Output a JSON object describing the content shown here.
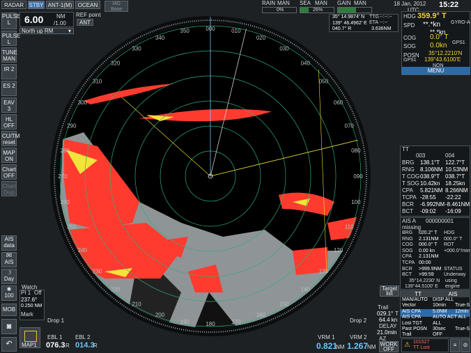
{
  "top_bar": {
    "radar": "RADAR",
    "stby": "STBY",
    "ant": "ANT-1(M)",
    "ocean": "OCEAN",
    "iad_base": "IAD\nBase",
    "pulse_lbl": "PULSE",
    "pulse_val": "L",
    "range_main": "6.00",
    "range_unit": "NM",
    "range_rings": "/1.00",
    "ref_point_lbl": "REF point",
    "ref_point_val": "ANT",
    "orientation": "North up RM",
    "rain_lbl": "RAIN",
    "rain_mode": "MAN",
    "rain_pct": "0%",
    "rain_level": 0.0,
    "sea_lbl": "SEA",
    "sea_mode": "MAN",
    "sea_pct": "26%",
    "sea_level": 0.26,
    "gain_lbl": "GAIN",
    "gain_mode": "MAN",
    "gain_level": 0.55,
    "date": "18 Jan, 2012",
    "time": "15:22",
    "tz": "UTC"
  },
  "cursor": {
    "lat": "35° 14.9874' N",
    "lon": "139° 46.4962' E",
    "brg": "040.7° R",
    "rng": "3.636NM",
    "ttg_lbl": "TTG",
    "eta_lbl": "ETA",
    "ttg_val": "--:--:--",
    "eta_val": "--:--"
  },
  "nav": {
    "hdg_lbl": "HDG",
    "hdg_val": "359.9° T",
    "hdg_src": "GYRO-A",
    "spd_lbl": "SPD",
    "spd_val": "**.*kn",
    "spd_src": "**.*kn",
    "cog_lbl": "COG",
    "cog_val": "0.0° T",
    "sog_lbl": "SOG",
    "sog_val": "0.0kn",
    "gps1": "GPS1",
    "posn_lbl": "POSN",
    "posn_lat": "35°12.2210'N",
    "posn_lon": "139°43.6100'E",
    "posn_src": "GPS1",
    "non": "NON",
    "menu": "MENU"
  },
  "left_menu": [
    "PULSE L",
    "TUNE MAN",
    "IR 2",
    "ES 2",
    "EAV 3",
    "HL OFF",
    "CU/TM reset",
    "MAP ON",
    "Chart OFF",
    "Chart Disp"
  ],
  "left_bottom": {
    "ais_data": "AIS data",
    "ais": "AIS",
    "day": "Day",
    "brill": "100",
    "mob": "MOB",
    "watch": "Watch",
    "pi1": "PI 1",
    "pi_off": "Off",
    "pi_val1": "237.6°",
    "pi_val2": "0.250 NM",
    "mark": "Mark",
    "map1": "MAP1",
    "drop1": "Drop 1",
    "ebl1": "EBL 1",
    "ebl1_val": "076.3",
    "ebl2": "EBL 2",
    "ebl2_val": "014.3",
    "r": "R"
  },
  "bottom_right": {
    "drop2": "Drop 2",
    "trail": "Trail",
    "trail_val": "029.1°",
    "trail_r": "T",
    "trail_rng": "64.4 kn",
    "delay": "DELAY",
    "delay_val": "21.0min",
    "vrm1": "VRM 1",
    "vrm1_val": "0.821",
    "vrm2": "VRM 2",
    "vrm2_val": "1.267",
    "nm": "NM",
    "az": "AZ",
    "work": "WORK",
    "off": "OFF",
    "alert_num": "101527",
    "alert_txt": "TT Lost"
  },
  "scale": {
    "outer": [
      "000",
      "010",
      "020",
      "030",
      "040",
      "050",
      "060",
      "070",
      "080",
      "090",
      "100",
      "110",
      "120",
      "130",
      "140",
      "150",
      "160",
      "170",
      "180",
      "190",
      "200",
      "210",
      "220",
      "230",
      "240",
      "250",
      "260",
      "270",
      "280",
      "290",
      "300",
      "310",
      "320",
      "330",
      "340",
      "350"
    ]
  },
  "tt_panel": {
    "title": "TT",
    "id1": "003",
    "id2": "004",
    "rows": [
      {
        "k": "BRG",
        "a": "138.1°T",
        "b": "122.7°T"
      },
      {
        "k": "RNG",
        "a": "8.106NM",
        "b": "10.53NM"
      },
      {
        "k": "T COG",
        "a": "038.9°T",
        "b": "038.7°T"
      },
      {
        "k": "T SOG",
        "a": "10.42kn",
        "b": "18.25kn"
      },
      {
        "k": "CPA",
        "a": "5.821NM",
        "b": "8.266NM"
      },
      {
        "k": "TCPA",
        "a": "-28:55",
        "b": "-22:22"
      },
      {
        "k": "BCR",
        "a": "-6.992NM",
        "b": "-8.461NM"
      },
      {
        "k": "BCT",
        "a": "-09:02",
        "b": "-16:09"
      }
    ]
  },
  "ais_panel": {
    "title": "AIS A",
    "mmsi": "000000001",
    "status": "missing",
    "rows": [
      {
        "k": "BRG",
        "a": "020.2° T",
        "c": "HDG"
      },
      {
        "k": "RNG",
        "a": "2.131NM",
        "c": "000.0° T"
      },
      {
        "k": "COG",
        "a": "000.0° T",
        "c": "ROT"
      },
      {
        "k": "SOG",
        "a": "0.00 kn",
        "c": "+000.0°/min"
      },
      {
        "k": "CPA",
        "a": "2.131NM",
        "c": ""
      },
      {
        "k": "TCPA",
        "a": "00:00",
        "c": ""
      },
      {
        "k": "BCR",
        "a": ">999.9NM",
        "c": "STATUS"
      },
      {
        "k": "BCT",
        "a": ">99:59",
        "c": "Underway"
      }
    ],
    "pos1": "35°14.2230' N",
    "pos2": "139°44.5100' E",
    "using": "using",
    "engine": "engine"
  },
  "target_menu": {
    "target_list": "Target list",
    "tt": "TT",
    "ais": "AIS",
    "rows": [
      {
        "k": "MAN/AUTO",
        "v": "DISP ALL"
      },
      {
        "k": "Vector",
        "v": "10min",
        "w": "True-S"
      },
      {
        "k": "AIS CPA",
        "v": "5.0NM",
        "w": "12min"
      },
      {
        "k": "AIS CPA",
        "v": "AUTO ACT ALL"
      },
      {
        "k": "Lost TGT",
        "v": "ALL"
      },
      {
        "k": "Past POSN",
        "v": "30sec",
        "w": "True-S"
      },
      {
        "k": "Trail",
        "v": "OFF"
      }
    ]
  },
  "colors": {
    "echo_red": "#ff3b2f",
    "echo_yellow": "#f2e43a",
    "land_gray": "#8f9496",
    "ring": "#2fae7c",
    "heading": "#6cc6ff"
  }
}
